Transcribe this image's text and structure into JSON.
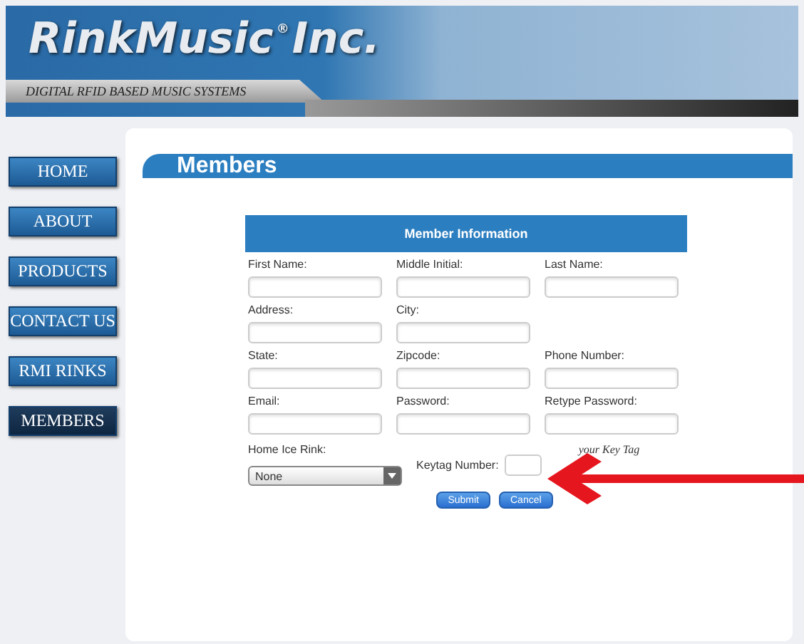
{
  "header": {
    "logo": "RinkMusic",
    "logo_mark": "®",
    "logo_suffix": "Inc.",
    "tagline": "DIGITAL RFID BASED MUSIC SYSTEMS"
  },
  "nav": [
    {
      "label": "HOME",
      "selected": false
    },
    {
      "label": "ABOUT",
      "selected": false
    },
    {
      "label": "PRODUCTS",
      "selected": false
    },
    {
      "label": "CONTACT US",
      "selected": false
    },
    {
      "label": "RMI RINKS",
      "selected": false
    },
    {
      "label": "MEMBERS",
      "selected": true
    }
  ],
  "page_title": "Members",
  "form": {
    "title": "Member Information",
    "rows": [
      [
        {
          "label": "First Name:"
        },
        {
          "label": "Middle Initial:"
        },
        {
          "label": "Last Name:"
        }
      ],
      [
        {
          "label": "Address:"
        },
        {
          "label": "City:"
        }
      ],
      [
        {
          "label": "State:"
        },
        {
          "label": "Zipcode:"
        },
        {
          "label": "Phone Number:"
        }
      ],
      [
        {
          "label": "Email:"
        },
        {
          "label": "Password:"
        },
        {
          "label": "Retype Password:"
        }
      ]
    ],
    "rink": {
      "label": "Home Ice Rink:",
      "value": "None"
    },
    "keytag": {
      "label": "Keytag Number:",
      "note": "your Key Tag"
    },
    "buttons": [
      "Submit",
      "Cancel"
    ]
  }
}
